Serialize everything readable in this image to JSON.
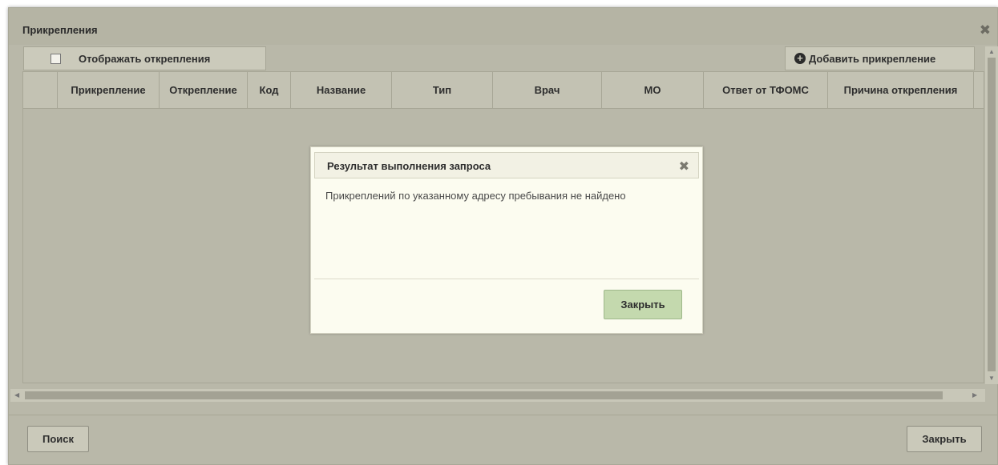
{
  "window": {
    "title": "Прикрепления",
    "close_icon": "close-icon"
  },
  "toolbar": {
    "show_detachments_label": "Отображать открепления",
    "show_detachments_checked": false,
    "add_attachment_label": "Добавить прикрепление"
  },
  "grid": {
    "columns": [
      "Прикрепление",
      "Открепление",
      "Код",
      "Название",
      "Тип",
      "Врач",
      "МО",
      "Ответ от ТФОМС",
      "Причина открепления"
    ],
    "rows": []
  },
  "footer": {
    "search_label": "Поиск",
    "close_label": "Закрыть"
  },
  "dialog": {
    "title": "Результат выполнения запроса",
    "message": "Прикреплений по указанному адресу пребывания не найдено",
    "close_button_label": "Закрыть"
  },
  "colors": {
    "accent_button": "#c4d9ae",
    "window_bg": "#b9b8a9",
    "dialog_bg": "#fcfcf0"
  }
}
